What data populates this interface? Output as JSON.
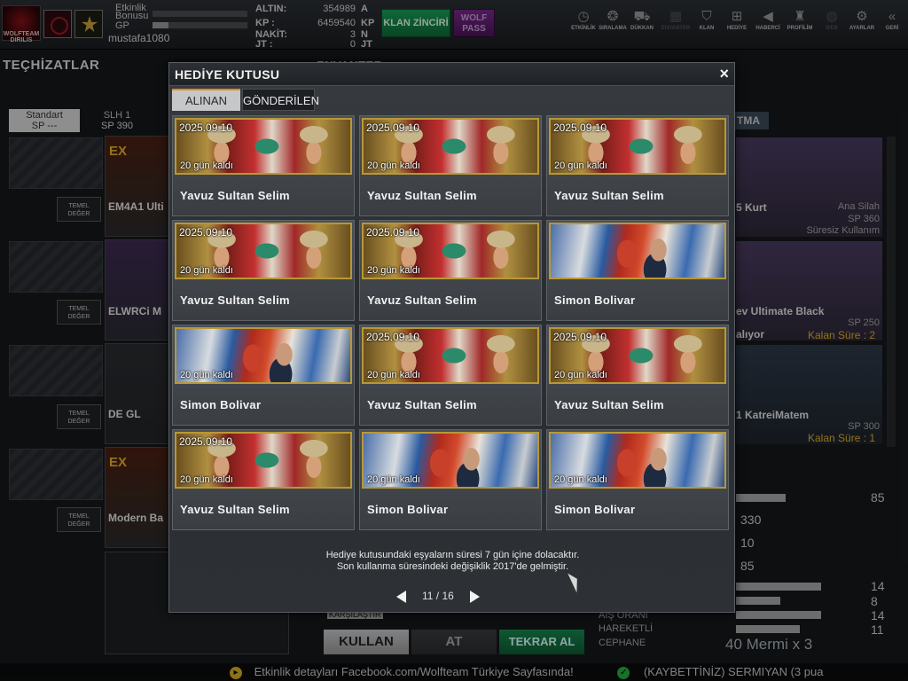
{
  "topbar": {
    "logo_text": "WOLFTEAM DIRILIS",
    "event_bonus_label_1": "Etkinlik",
    "event_bonus_label_2": "Bonusu",
    "gp_label": "GP",
    "username": "mustafa1080",
    "currencies": [
      {
        "label": "ALTIN:",
        "value": "354989",
        "unit": "A"
      },
      {
        "label": "KP :",
        "value": "6459540",
        "unit": "KP"
      },
      {
        "label": "NAKİT:",
        "value": "3",
        "unit": "N"
      },
      {
        "label": "JT :",
        "value": "0",
        "unit": "JT"
      }
    ],
    "clan_chain_label": "KLAN ZİNCİRİ",
    "wolf_pass_label": "WOLF PASS",
    "nav": [
      {
        "label": "ETKİNLİK",
        "icon": "clock-icon",
        "glyph": "◷",
        "dim": false
      },
      {
        "label": "SIRALAMA",
        "icon": "rank-icon",
        "glyph": "❂",
        "dim": false
      },
      {
        "label": "DÜKKAN",
        "icon": "cart-icon",
        "glyph": "⛟",
        "dim": false
      },
      {
        "label": "ENVANTER",
        "icon": "inventory-icon",
        "glyph": "▦",
        "dim": true
      },
      {
        "label": "KLAN",
        "icon": "shield-icon",
        "glyph": "⛉",
        "dim": false
      },
      {
        "label": "HEDİYE",
        "icon": "gift-icon",
        "glyph": "⊞",
        "dim": false
      },
      {
        "label": "HABERCİ",
        "icon": "megaphone-icon",
        "glyph": "◀",
        "dim": false
      },
      {
        "label": "PROFİLİM",
        "icon": "profile-icon",
        "glyph": "♜",
        "dim": false
      },
      {
        "label": "WEB",
        "icon": "globe-icon",
        "glyph": "◍",
        "dim": true
      },
      {
        "label": "AYARLAR",
        "icon": "gear-icon",
        "glyph": "⚙",
        "dim": false
      },
      {
        "label": "GERİ",
        "icon": "back-icon",
        "glyph": "«",
        "dim": false
      }
    ]
  },
  "background": {
    "equipment_title": "TEÇHİZATLAR",
    "inventory_title": "ENVANTER",
    "tabs": [
      {
        "name": "Standart",
        "sp": "SP ---"
      },
      {
        "name": "SLH 1",
        "sp": "SP 390"
      }
    ],
    "temel_label_1": "TEMEL",
    "temel_label_2": "DEĞER",
    "weapons": [
      "EM4A1 Ulti",
      "ELWRCi M",
      "DE GL",
      "Modern Ba"
    ],
    "ex_label": "EX",
    "right_tab": "TMA",
    "right_items": [
      {
        "name": "5 Kurt",
        "sub1": "Ana Silah",
        "sub2": "SP 360",
        "sub3": "Süresiz Kullanım"
      },
      {
        "name": "ev Ultimate Black",
        "sub1": "SP 250",
        "sub2": "alıyor",
        "sub3": "Kalan Süre : 2"
      },
      {
        "name": "1 KatreiMatem",
        "sub1": "SP 300",
        "sub2": "",
        "sub3": "Kalan Süre : 1"
      }
    ],
    "stat_values": [
      "85",
      "330",
      "10",
      "85",
      "14",
      "8",
      "14",
      "11"
    ],
    "stat_labels": [
      "AİŞ ORANI",
      "HAREKETLİ",
      "CEPHANE"
    ],
    "ammo": "40 Mermi x 3",
    "compare_label": "KARŞILAŞTIR",
    "use_button": "KULLAN",
    "at_button": "AT",
    "retry_button": "TEKRAR AL",
    "ticker_left": "Etkinlik detayları Facebook.com/Wolfteam Türkiye Sayfasında!",
    "ticker_right": "(KAYBETTİNİZ) SERMIYAN (3 pua"
  },
  "dialog": {
    "title": "HEDİYE KUTUSU",
    "close": "×",
    "tabs": [
      "ALINAN",
      "GÖNDERİLEN"
    ],
    "items": [
      {
        "name": "Yavuz Sultan Selim",
        "date": "2025.09.10",
        "remaining": "20 gün kaldı",
        "art": "yavuz"
      },
      {
        "name": "Yavuz Sultan Selim",
        "date": "2025.09.10",
        "remaining": "20 gün kaldı",
        "art": "yavuz"
      },
      {
        "name": "Yavuz Sultan Selim",
        "date": "2025.09.10",
        "remaining": "20 gün kaldı",
        "art": "yavuz"
      },
      {
        "name": "Yavuz Sultan Selim",
        "date": "2025.09.10",
        "remaining": "20 gün kaldı",
        "art": "yavuz"
      },
      {
        "name": "Yavuz Sultan Selim",
        "date": "2025.09.10",
        "remaining": "20 gün kaldı",
        "art": "yavuz"
      },
      {
        "name": "Simon Bolivar",
        "date": "",
        "remaining": "",
        "art": "simon"
      },
      {
        "name": "Simon Bolivar",
        "date": "",
        "remaining": "20 gün kaldı",
        "art": "simon"
      },
      {
        "name": "Yavuz Sultan Selim",
        "date": "2025.09.10",
        "remaining": "20 gün kaldı",
        "art": "yavuz"
      },
      {
        "name": "Yavuz Sultan Selim",
        "date": "2025.09.10",
        "remaining": "20 gün kaldı",
        "art": "yavuz"
      },
      {
        "name": "Yavuz Sultan Selim",
        "date": "2025.09.10",
        "remaining": "20 gün kaldı",
        "art": "yavuz"
      },
      {
        "name": "Simon Bolivar",
        "date": "",
        "remaining": "20 gün kaldı",
        "art": "simon"
      },
      {
        "name": "Simon Bolivar",
        "date": "",
        "remaining": "20 gün kaldı",
        "art": "simon"
      }
    ],
    "notice_line1": "Hediye kutusundaki eşyaların süresi 7 gün içine dolacaktır.",
    "notice_line2": "Son kullanma süresindeki değişiklik 2017'de gelmiştir.",
    "page": "11 / 16"
  }
}
